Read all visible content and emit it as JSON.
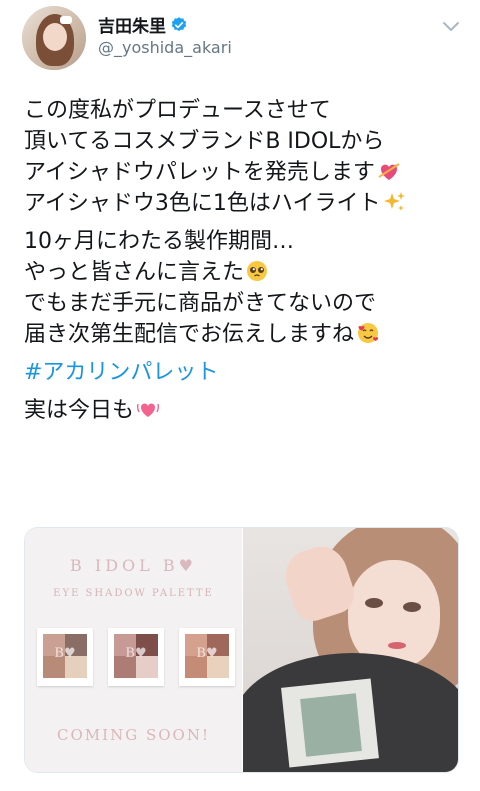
{
  "author": {
    "display_name": "吉田朱里",
    "handle": "@_yoshida_akari"
  },
  "tweet": {
    "paragraph1": [
      "この度私がプロデュースさせて",
      "頂いてるコスメブランドB IDOLから",
      "アイシャドウパレットを発売します",
      "アイシャドウ3色に1色はハイライト"
    ],
    "paragraph2": [
      "10ヶ月にわたる製作期間…",
      "やっと皆さんに言えた",
      "でもまだ手元に商品がきてないので",
      "届き次第生配信でお伝えしますね"
    ],
    "hashtag": "#アカリンパレット",
    "closing": "実は今日も"
  },
  "media": {
    "brand_title": "B IDOL B♥",
    "subtitle": "EYE SHADOW PALETTE",
    "coming_soon": "COMING SOON!",
    "palette_mark": "B♥"
  },
  "icons": {
    "verified": "verified-badge-icon",
    "more": "chevron-down-icon"
  },
  "colors": {
    "accent": "#1b95e0",
    "text": "#14171a",
    "muted": "#657786"
  }
}
